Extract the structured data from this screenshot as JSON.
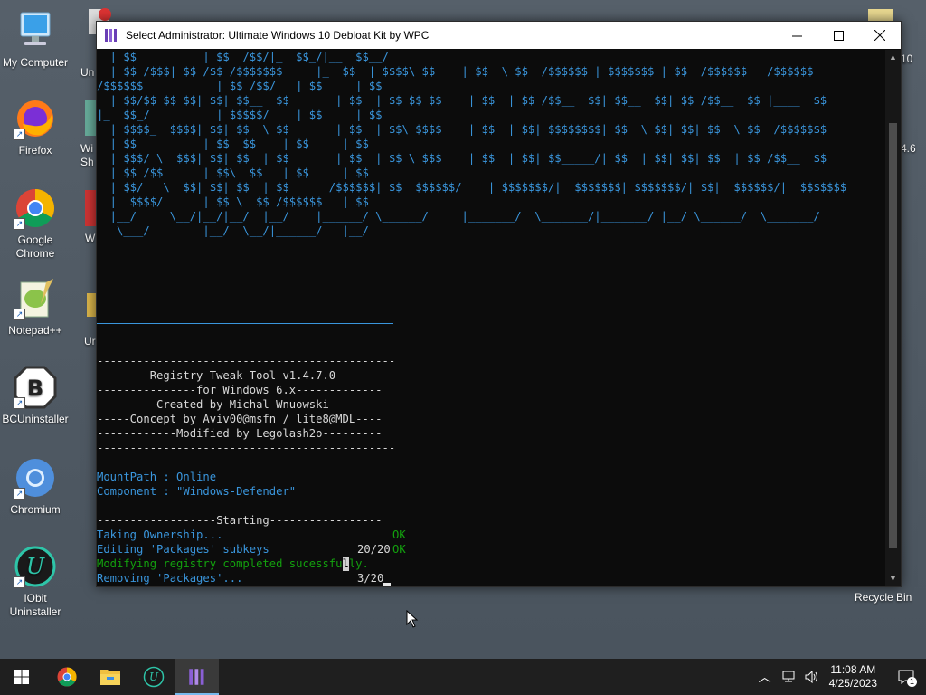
{
  "desktop": {
    "icons": [
      {
        "label": "My Computer"
      },
      {
        "label": "Firefox"
      },
      {
        "label": "Google Chrome"
      },
      {
        "label": "Notepad++"
      },
      {
        "label": "BCUninstaller"
      },
      {
        "label": "Chromium"
      },
      {
        "label": "IObit Uninstaller"
      }
    ],
    "partial_labels": [
      "Un",
      "Wi",
      "Sh",
      "W",
      "Ur",
      "10",
      "4.6"
    ],
    "recycle_bin": "Recycle Bin"
  },
  "window": {
    "title": "Select Administrator:  Ultimate Windows 10 Debloat Kit by WPC",
    "ascii_art": [
      "  | $$          | $$  /$$/|_  $$_/|__  $$__/",
      "  | $$ /$$$| $$ /$$ /$$$$$$$     |_  $$  | $$$$\\ $$    | $$  \\ $$  /$$$$$$ | $$$$$$$ | $$  /$$$$$$   /$$$$$$",
      "/$$$$$$           | $$ /$$/   | $$     | $$",
      "  | $$/$$ $$ $$| $$| $$__  $$       | $$  | $$ $$ $$    | $$  | $$ /$$__  $$| $$__  $$| $$ /$$__  $$ |____  $$",
      "|_  $$_/          | $$$$$/    | $$     | $$",
      "  | $$$$_  $$$$| $$| $$  \\ $$       | $$  | $$\\ $$$$    | $$  | $$| $$$$$$$$| $$  \\ $$| $$| $$  \\ $$  /$$$$$$$",
      "  | $$          | $$  $$    | $$     | $$",
      "  | $$$/ \\  $$$| $$| $$  | $$       | $$  | $$ \\ $$$    | $$  | $$| $$_____/| $$  | $$| $$| $$  | $$ /$$__  $$",
      "  | $$ /$$      | $$\\  $$   | $$     | $$",
      "  | $$/   \\  $$| $$| $$  | $$      /$$$$$$| $$  $$$$$$/    | $$$$$$$/|  $$$$$$$| $$$$$$$/| $$|  $$$$$$/|  $$$$$$$",
      "  |  $$$$/      | $$ \\  $$ /$$$$$$   | $$",
      "  |__/     \\__/|__/|__/  |__/    |______/ \\______/     |_______/  \\_______/|_______/ |__/ \\______/  \\_______/",
      "   \\___/        |__/  \\__/|______/   |__/"
    ],
    "header_lines": [
      "---------------------------------------------",
      "--------Registry Tweak Tool v1.4.7.0-------",
      "---------------for Windows 6.x-------------",
      "---------Created by Michal Wnuowski--------",
      "-----Concept by Aviv00@msfn / lite8@MDL----",
      "------------Modified by Legolash2o---------",
      "---------------------------------------------"
    ],
    "mount_path": "MountPath : Online",
    "component": "Component : \"Windows-Defender\"",
    "starting": "------------------Starting-----------------",
    "status_lines": [
      {
        "text": "Taking Ownership...",
        "value": "OK"
      },
      {
        "text": "Editing 'Packages' subkeys",
        "value": "20/20",
        "suffix": "OK"
      }
    ],
    "success_line_a": "Modifying registry completed sucessfu",
    "success_line_caret": "l",
    "success_line_b": "ly.",
    "removing_line": "Removing 'Packages'...",
    "removing_value": "3/20"
  },
  "taskbar": {
    "time": "11:08 AM",
    "date": "4/25/2023",
    "notification_count": "1"
  },
  "colors": {
    "console_bg": "#0c0c0c",
    "ascii_blue": "#3a96dd",
    "ok_green": "#13a10e",
    "text_white": "#d8d8d8"
  }
}
